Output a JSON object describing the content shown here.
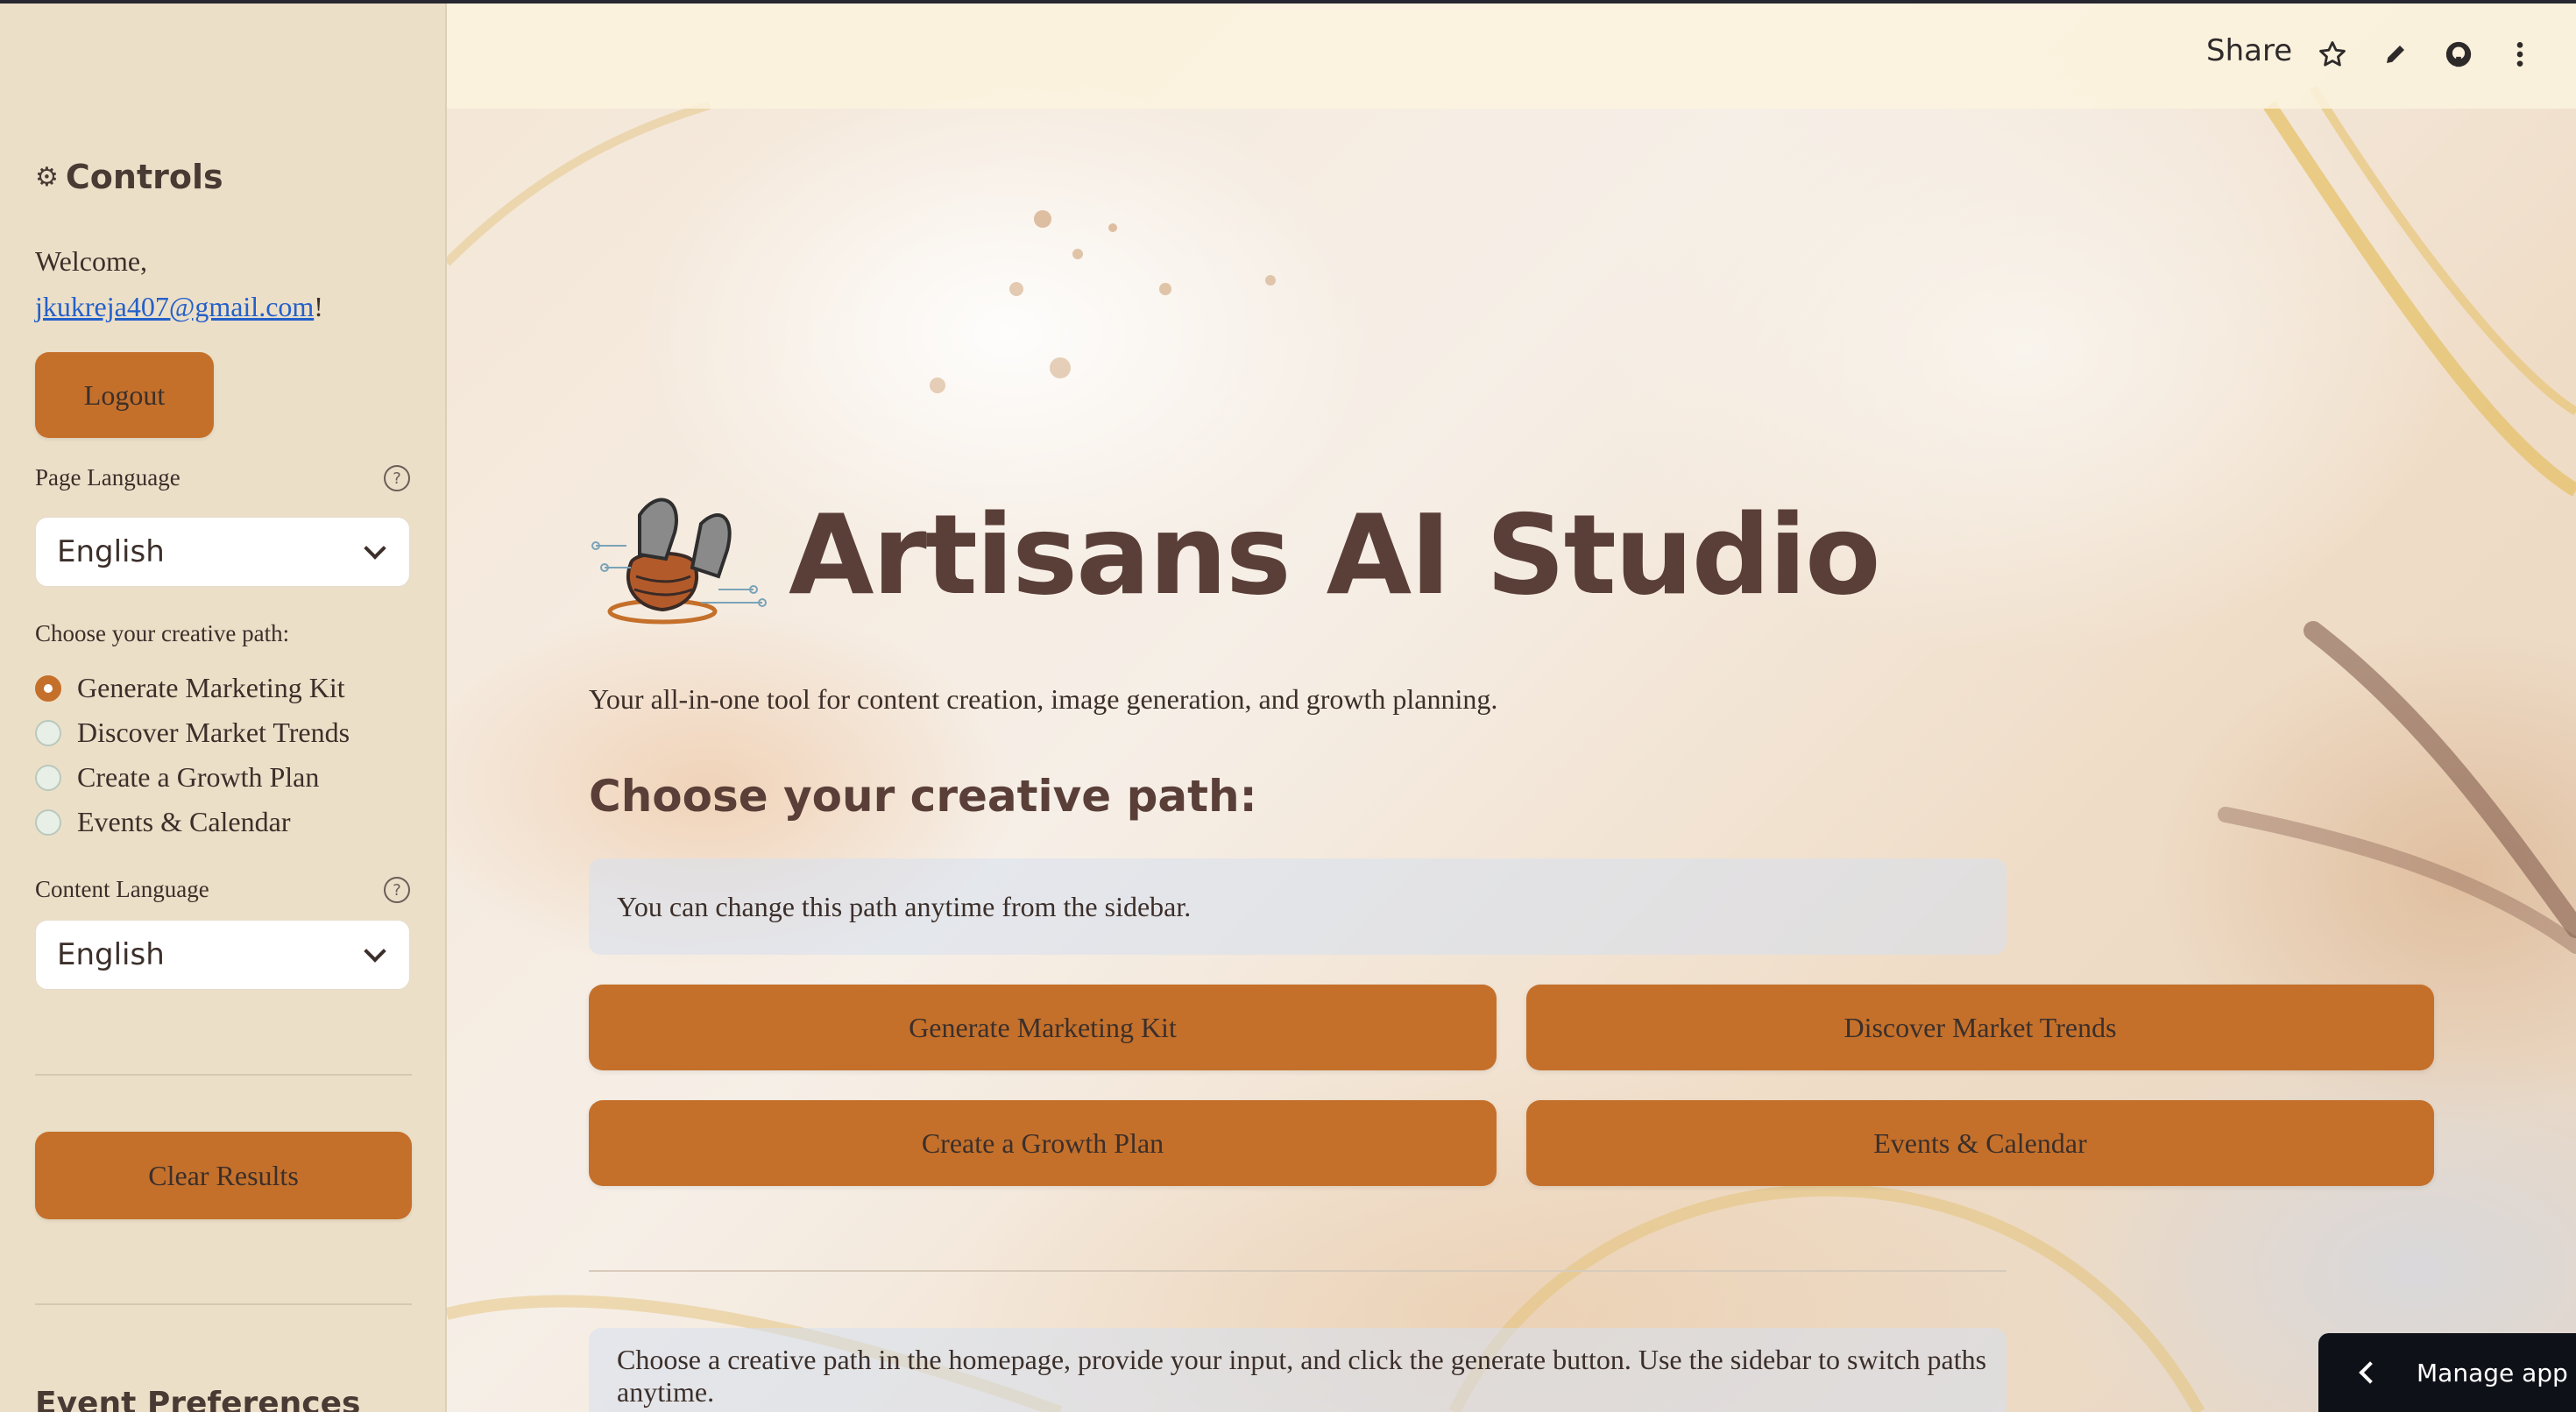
{
  "sidebar": {
    "heading_icon": "gear-icon",
    "heading": "Controls",
    "welcome_prefix": "Welcome,",
    "user_email": "jkukreja407@gmail.com",
    "welcome_suffix": "!",
    "logout_label": "Logout",
    "page_language_label": "Page Language",
    "page_language_value": "English",
    "path_label": "Choose your creative path:",
    "paths": [
      {
        "label": "Generate Marketing Kit",
        "selected": true
      },
      {
        "label": "Discover Market Trends",
        "selected": false
      },
      {
        "label": "Create a Growth Plan",
        "selected": false
      },
      {
        "label": "Events & Calendar",
        "selected": false
      }
    ],
    "content_language_label": "Content Language",
    "content_language_value": "English",
    "clear_label": "Clear Results",
    "event_preferences": "Event Preferences"
  },
  "header": {
    "share_label": "Share",
    "icons": [
      "star-icon",
      "edit-icon",
      "github-icon",
      "more-icon"
    ]
  },
  "main": {
    "logo_icon": "pottery-logo-icon",
    "title": "Artisans AI Studio",
    "subtitle": "Your all-in-one tool for content creation, image generation, and growth planning.",
    "section_heading": "Choose your creative path:",
    "info_text": "You can change this path anytime from the sidebar.",
    "buttons": [
      "Generate Marketing Kit",
      "Discover Market Trends",
      "Create a Growth Plan",
      "Events & Calendar"
    ],
    "footer_info": "Choose a creative path in the homepage, provide your input, and click the generate button. Use the sidebar to switch paths anytime."
  },
  "manage_app_label": "Manage app",
  "colors": {
    "accent": "#c4702b",
    "sidebar_bg": "#ecdfc8",
    "title": "#5a3f38"
  }
}
